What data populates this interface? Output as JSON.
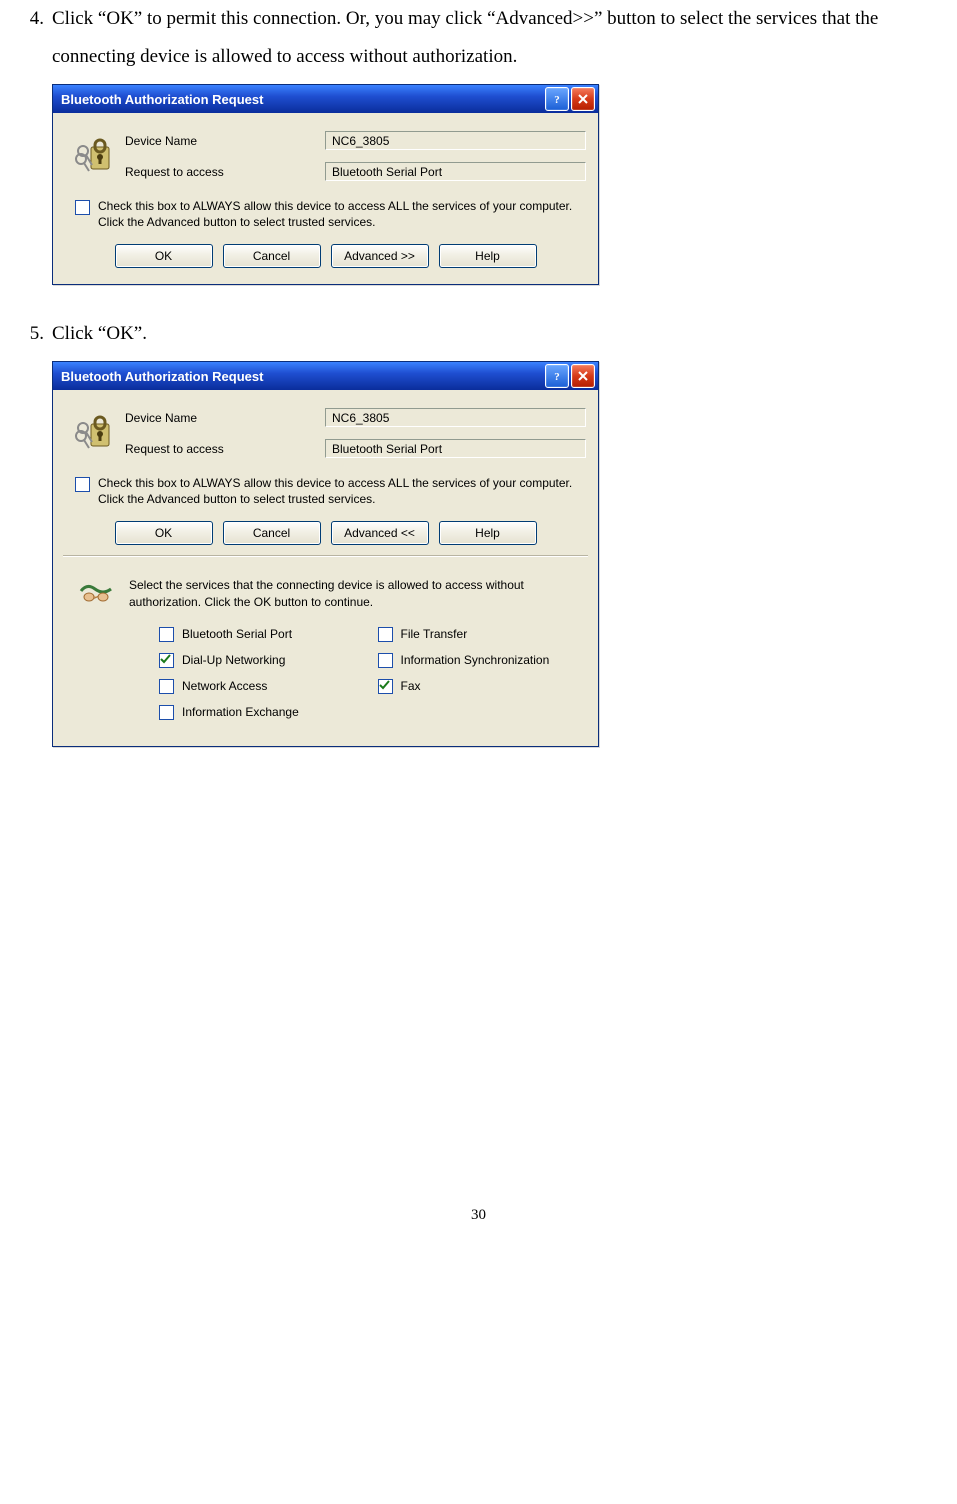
{
  "step4": {
    "number": "4.",
    "text": "Click “OK” to permit this connection. Or, you may click “Advanced>>” button to select the services that the connecting device is allowed to access without authorization."
  },
  "step5": {
    "number": "5.",
    "text": "Click “OK”."
  },
  "dialog1": {
    "title": "Bluetooth Authorization Request",
    "labels": {
      "device": "Device Name",
      "request": "Request to access"
    },
    "values": {
      "device": "NC6_3805",
      "request": "Bluetooth Serial Port"
    },
    "checkbox_text": "Check this box to ALWAYS allow this device to access ALL the services of your computer. Click the Advanced button to select trusted services.",
    "buttons": {
      "ok": "OK",
      "cancel": "Cancel",
      "advanced": "Advanced >>",
      "help": "Help"
    }
  },
  "dialog2": {
    "title": "Bluetooth Authorization Request",
    "labels": {
      "device": "Device Name",
      "request": "Request to access"
    },
    "values": {
      "device": "NC6_3805",
      "request": "Bluetooth Serial Port"
    },
    "checkbox_text": "Check this box to ALWAYS allow this device to access ALL the services of your computer. Click the Advanced button to select trusted services.",
    "buttons": {
      "ok": "OK",
      "cancel": "Cancel",
      "advanced": "Advanced <<",
      "help": "Help"
    },
    "advanced_text": "Select the services that the connecting device is allowed to access without authorization.  Click the OK button to continue.",
    "services": {
      "s0": "Bluetooth Serial Port",
      "s1": "File Transfer",
      "s2": "Dial-Up Networking",
      "s3": "Information Synchronization",
      "s4": "Network Access",
      "s5": "Fax",
      "s6": "Information Exchange"
    }
  },
  "page_number": "30"
}
